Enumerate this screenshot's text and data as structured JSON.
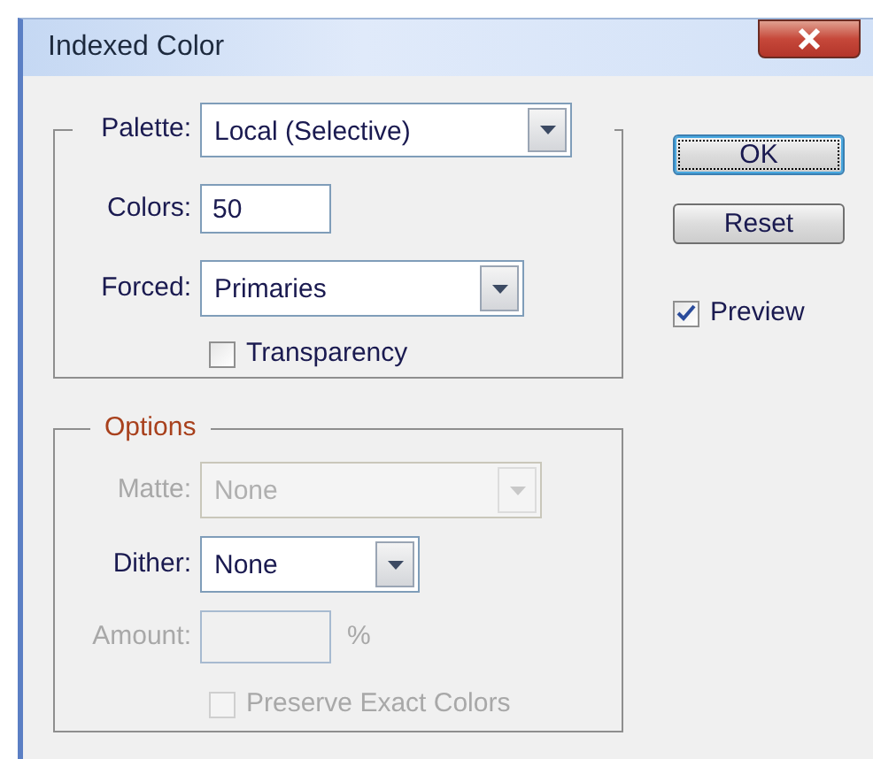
{
  "window": {
    "title": "Indexed Color"
  },
  "palette_group": {
    "fields": [
      {
        "kind": "select",
        "label": "Palette:",
        "value": "Local (Selective)",
        "disabled": false
      },
      {
        "kind": "text",
        "label": "Colors:",
        "value": "50",
        "disabled": false
      },
      {
        "kind": "select",
        "label": "Forced:",
        "value": "Primaries",
        "disabled": false
      },
      {
        "kind": "checkbox",
        "label": "Transparency",
        "checked": false,
        "disabled": false
      }
    ]
  },
  "options_group": {
    "legend": "Options",
    "fields": [
      {
        "kind": "select",
        "label": "Matte:",
        "value": "None",
        "disabled": true
      },
      {
        "kind": "select",
        "label": "Dither:",
        "value": "None",
        "disabled": false
      },
      {
        "kind": "text",
        "label": "Amount:",
        "suffix": "%",
        "disabled": true
      },
      {
        "kind": "checkbox",
        "label": "Preserve Exact Colors",
        "checked": false,
        "disabled": true
      }
    ]
  },
  "buttons": [
    {
      "label": "OK",
      "default": true
    },
    {
      "label": "Reset",
      "default": false
    }
  ],
  "preview": {
    "label": "Preview",
    "checked": true
  }
}
